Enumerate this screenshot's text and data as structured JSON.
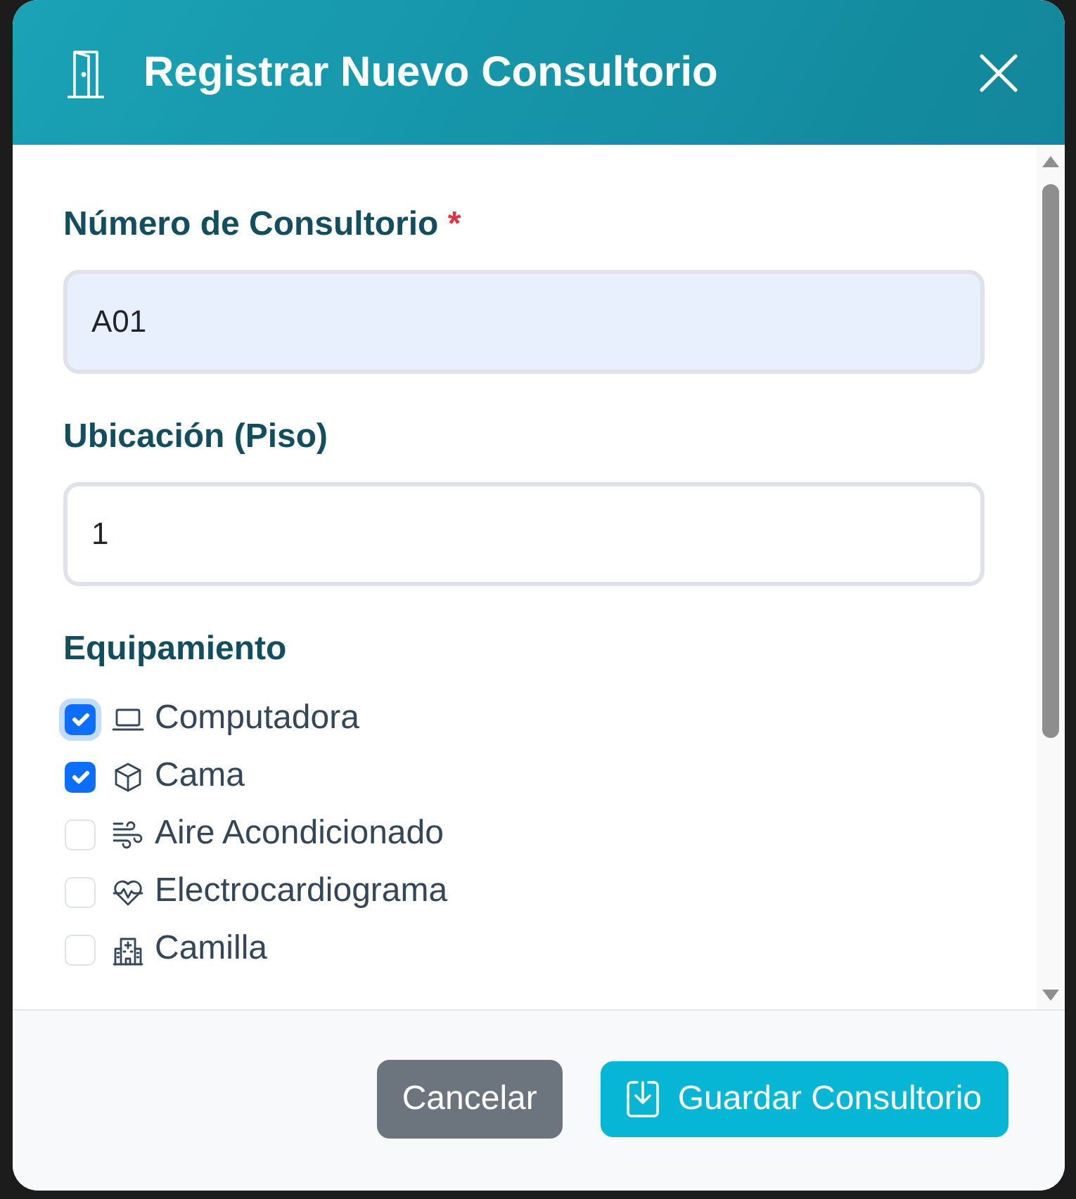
{
  "dialog": {
    "title": "Registrar Nuevo Consultorio"
  },
  "fields": [
    {
      "label": "Número de Consultorio",
      "required_mark": "*",
      "value": "A01",
      "autofilled": true
    },
    {
      "label": "Ubicación (Piso)",
      "value": "1",
      "autofilled": false
    }
  ],
  "equipment": {
    "label": "Equipamiento",
    "items": [
      {
        "label": "Computadora",
        "checked": true,
        "focused": true
      },
      {
        "label": "Cama",
        "checked": true,
        "focused": false
      },
      {
        "label": "Aire Acondicionado",
        "checked": false,
        "focused": false
      },
      {
        "label": "Electrocardiograma",
        "checked": false,
        "focused": false
      },
      {
        "label": "Camilla",
        "checked": false,
        "focused": false
      }
    ]
  },
  "buttons": [
    {
      "label": "Cancelar",
      "kind": "secondary"
    },
    {
      "label": "Guardar Consultorio",
      "kind": "primary"
    }
  ]
}
